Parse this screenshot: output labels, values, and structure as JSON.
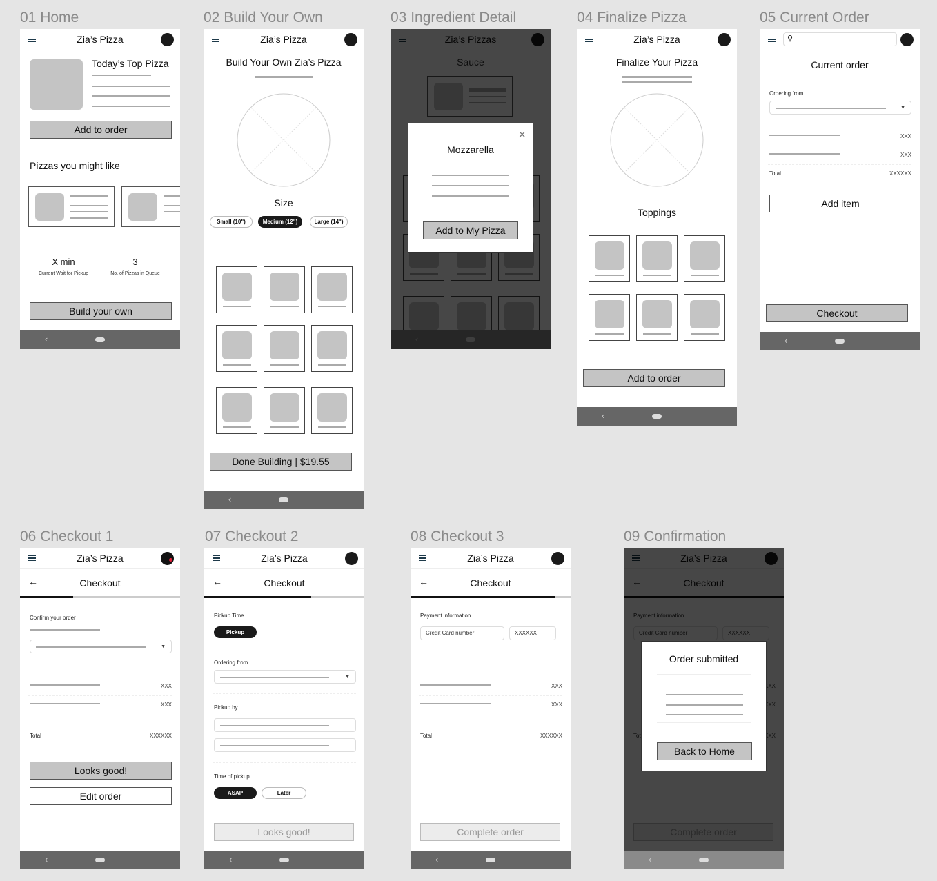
{
  "app_title": "Zia’s Pizza",
  "frames": [
    {
      "label": "01 Home"
    },
    {
      "label": "02 Build Your Own"
    },
    {
      "label": "03 Ingredient Detail"
    },
    {
      "label": "04 Finalize Pizza"
    },
    {
      "label": "05 Current Order"
    },
    {
      "label": "06 Checkout 1"
    },
    {
      "label": "07 Checkout 2"
    },
    {
      "label": "08 Checkout 3"
    },
    {
      "label": "09 Confirmation"
    }
  ],
  "home": {
    "top_pizza_title": "Today’s Top Pizza",
    "add_to_order": "Add to order",
    "suggestions_title": "Pizzas you might like",
    "wait_value": "X min",
    "wait_label": "Current Wait for Pickup",
    "queue_value": "3",
    "queue_label": "No. of Pizzas in Queue",
    "build_button": "Build your own"
  },
  "build": {
    "title": "Build Your Own Zia’s Pizza",
    "size_label": "Size",
    "sizes": [
      {
        "label": "Small (10\")",
        "selected": false
      },
      {
        "label": "Medium (12\")",
        "selected": true
      },
      {
        "label": "Large (14\")",
        "selected": false
      }
    ],
    "done_button": "Done Building | $19.55"
  },
  "ingredient": {
    "bg_title": "Zia’s Pizzas",
    "bg_section": "Sauce",
    "modal_title": "Mozzarella",
    "add_button": "Add to My Pizza"
  },
  "finalize": {
    "title": "Finalize Your Pizza",
    "toppings_label": "Toppings",
    "add_button": "Add to order"
  },
  "current_order": {
    "title": "Current order",
    "ordering_from_label": "Ordering from",
    "item_prices": [
      "XXX",
      "XXX"
    ],
    "total_label": "Total",
    "total_value": "XXXXXX",
    "add_item_button": "Add item",
    "checkout_button": "Checkout"
  },
  "checkout1": {
    "title": "Checkout",
    "progress": 0.33,
    "confirm_label": "Confirm your order",
    "item_prices": [
      "XXX",
      "XXX"
    ],
    "total_label": "Total",
    "total_value": "XXXXXX",
    "looks_good": "Looks good!",
    "edit_order": "Edit order"
  },
  "checkout2": {
    "title": "Checkout",
    "progress": 0.67,
    "pickup_time_label": "Pickup Time",
    "pickup_chip": "Pickup",
    "ordering_from_label": "Ordering from",
    "pickup_by_label": "Pickup by",
    "time_of_pickup_label": "Time of pickup",
    "time_options": [
      {
        "label": "ASAP",
        "selected": true
      },
      {
        "label": "Later",
        "selected": false
      }
    ],
    "looks_good": "Looks good!"
  },
  "checkout3": {
    "title": "Checkout",
    "progress": 0.9,
    "payment_label": "Payment information",
    "card_placeholder": "Credit Card number",
    "cvv_value": "XXXXXX",
    "item_prices": [
      "XXX",
      "XXX"
    ],
    "total_label": "Total",
    "total_value": "XXXXXX",
    "complete_button": "Complete order"
  },
  "confirmation": {
    "modal_title": "Order submitted",
    "back_button": "Back to Home"
  },
  "nav": {
    "back_glyph": "‹"
  }
}
